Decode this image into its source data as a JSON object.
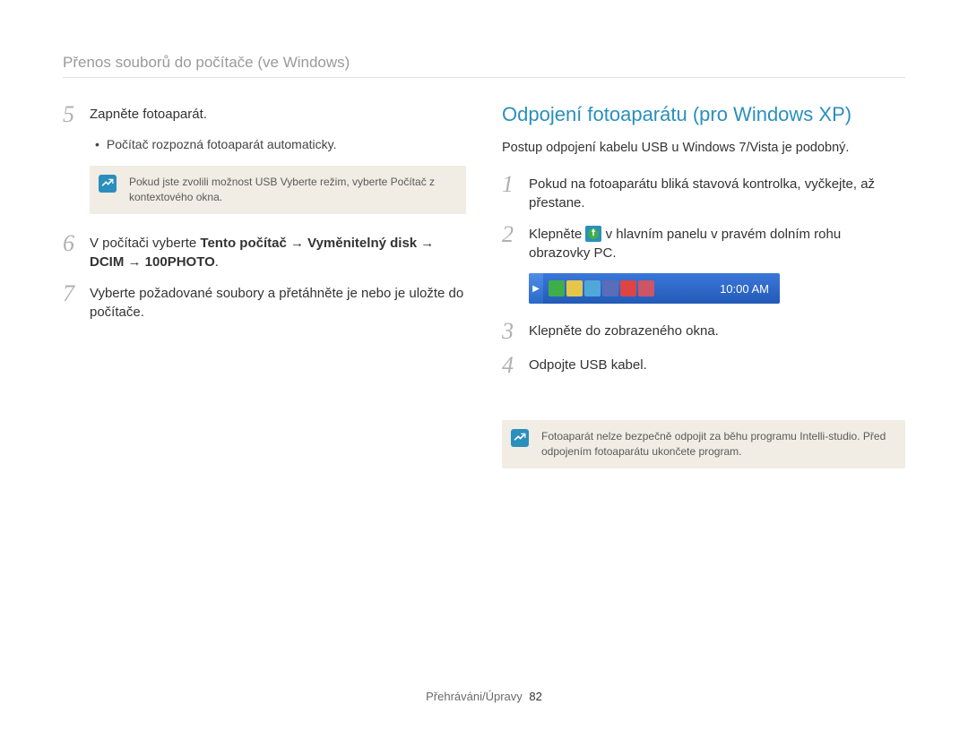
{
  "breadcrumb": "Přenos souborů do počítače (ve Windows)",
  "left": {
    "step5": {
      "num": "5",
      "text": "Zapněte fotoaparát."
    },
    "bullet5": "Počítač rozpozná fotoaparát automaticky.",
    "note5_a": "Pokud jste zvolili možnost USB ",
    "note5_bold1": "Vyberte režim",
    "note5_b": ", vyberte ",
    "note5_bold2": "Počítač",
    "note5_c": " z kontextového okna.",
    "step6": {
      "num": "6",
      "a": "V počítači vyberte ",
      "bold": "Tento počítač → Vyměnitelný disk → DCIM → 100PHOTO",
      "b": "."
    },
    "step7": {
      "num": "7",
      "text": "Vyberte požadované soubory a přetáhněte je nebo je uložte do počítače."
    }
  },
  "right": {
    "title": "Odpojení fotoaparátu (pro Windows XP)",
    "subnote": "Postup odpojení kabelu USB u Windows 7/Vista je podobný.",
    "step1": {
      "num": "1",
      "text": "Pokud na fotoaparátu bliká stavová kontrolka, vyčkejte, až přestane."
    },
    "step2": {
      "num": "2",
      "a": "Klepněte ",
      "b": " v hlavním panelu v pravém dolním rohu obrazovky PC."
    },
    "taskbar_time": "10:00 AM",
    "step3": {
      "num": "3",
      "text": "Klepněte do zobrazeného okna."
    },
    "step4": {
      "num": "4",
      "text": "Odpojte USB kabel."
    },
    "note": "Fotoaparát nelze bezpečně odpojit za běhu programu Intelli-studio. Před odpojením fotoaparátu ukončete program."
  },
  "footer": {
    "label": "Přehráváni/Úpravy",
    "page": "82"
  }
}
